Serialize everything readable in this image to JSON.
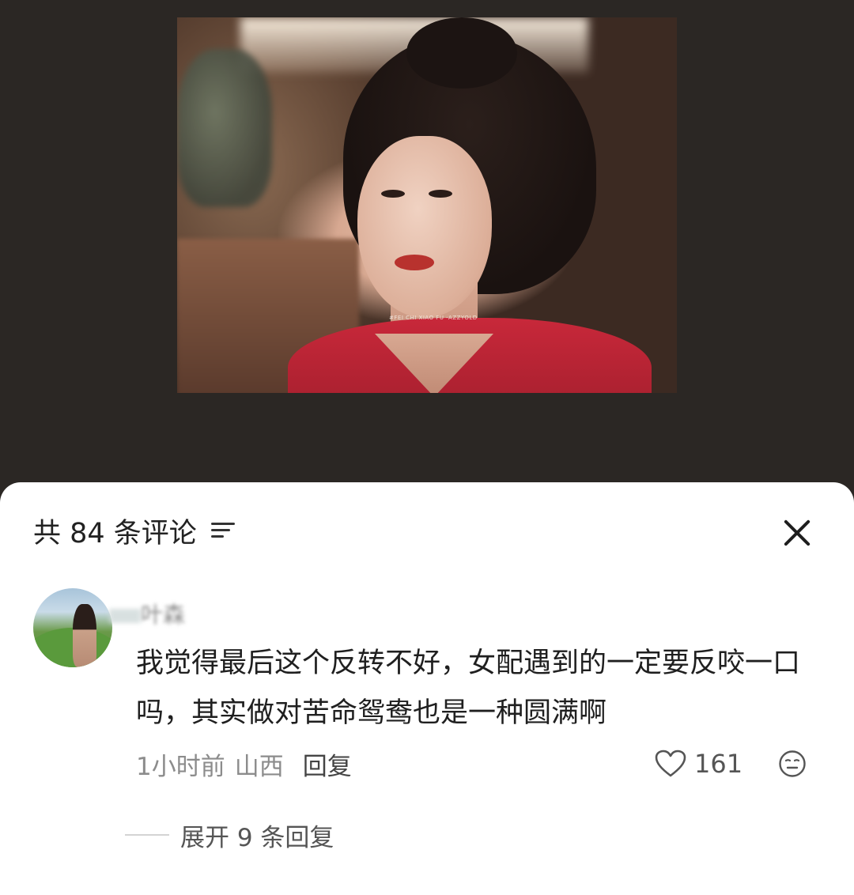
{
  "video": {
    "watermark": "#FEI CHI XIAO FU -AZZYOLD"
  },
  "comments_sheet": {
    "title": "共 84 条评论",
    "sort_icon": "sort-lines-icon",
    "close_icon": "close-icon"
  },
  "comment": {
    "username": "叶森",
    "text": "我觉得最后这个反转不好，女配遇到的一定要反咬一口吗，其实做对苦命鸳鸯也是一种圆满啊",
    "time": "1小时前",
    "location": "山西",
    "reply_label": "回复",
    "like_icon": "heart-outline-icon",
    "like_count": "161",
    "dislike_icon": "neutral-face-icon",
    "expand_label": "展开 9 条回复"
  },
  "colors": {
    "page_background": "#2b2724",
    "sheet_background": "#ffffff",
    "primary_text": "#1f1f1f",
    "secondary_text": "#8c8c8c"
  }
}
